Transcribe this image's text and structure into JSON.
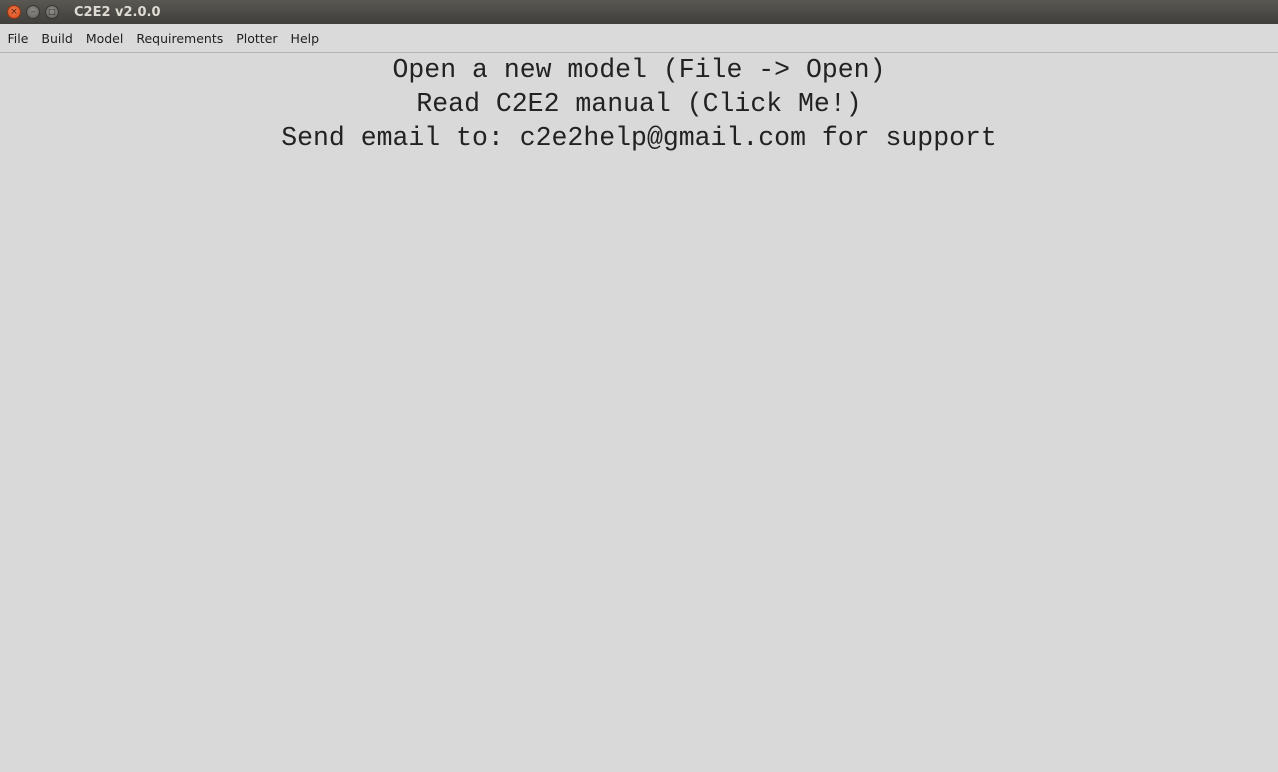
{
  "window": {
    "title": "C2E2 v2.0.0",
    "controls": {
      "close_glyph": "×",
      "minimize_glyph": "–",
      "maximize_glyph": "□"
    }
  },
  "menubar": {
    "items": [
      {
        "label": "File"
      },
      {
        "label": "Build"
      },
      {
        "label": "Model"
      },
      {
        "label": "Requirements"
      },
      {
        "label": "Plotter"
      },
      {
        "label": "Help"
      }
    ]
  },
  "main": {
    "open_model_text": "Open a new model (File -> Open)",
    "manual_link_text": "Read C2E2 manual (Click Me!)",
    "support_text": "Send email to: c2e2help@gmail.com for support"
  },
  "colors": {
    "background": "#d9d9d9",
    "titlebar": "#4a4945",
    "close_button": "#e25a2a"
  }
}
